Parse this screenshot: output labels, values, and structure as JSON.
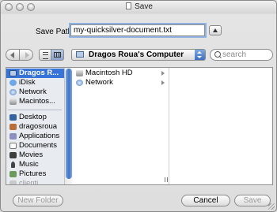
{
  "window": {
    "title": "Save"
  },
  "save_path": {
    "label": "Save Path:",
    "value": "my-quicksilver-document.txt"
  },
  "toolbar": {
    "location": "Dragos Roua's Computer",
    "search_placeholder": "search"
  },
  "sidebar": {
    "items": [
      {
        "label": "Dragos R...",
        "icon": "computer-icon",
        "selected": true
      },
      {
        "label": "iDisk",
        "icon": "idisk-icon"
      },
      {
        "label": "Network",
        "icon": "network-icon"
      },
      {
        "label": "Macintos...",
        "icon": "hard-disk-icon"
      },
      {
        "label": "Desktop",
        "icon": "desktop-icon"
      },
      {
        "label": "dragosroua",
        "icon": "home-icon"
      },
      {
        "label": "Applications",
        "icon": "applications-icon"
      },
      {
        "label": "Documents",
        "icon": "documents-icon"
      },
      {
        "label": "Movies",
        "icon": "movies-icon"
      },
      {
        "label": "Music",
        "icon": "music-icon"
      },
      {
        "label": "Pictures",
        "icon": "pictures-icon"
      },
      {
        "label": "clienti",
        "icon": "folder-icon"
      }
    ]
  },
  "column1": {
    "items": [
      {
        "label": "Macintosh HD",
        "icon": "hard-disk-icon"
      },
      {
        "label": "Network",
        "icon": "network-icon"
      }
    ]
  },
  "buttons": {
    "new_folder": "New Folder",
    "cancel": "Cancel",
    "save": "Save"
  },
  "colors": {
    "selection": "#3874d8",
    "scroll_thumb": "#3d72c8",
    "sidebar_bg": "#e8ecf1"
  }
}
